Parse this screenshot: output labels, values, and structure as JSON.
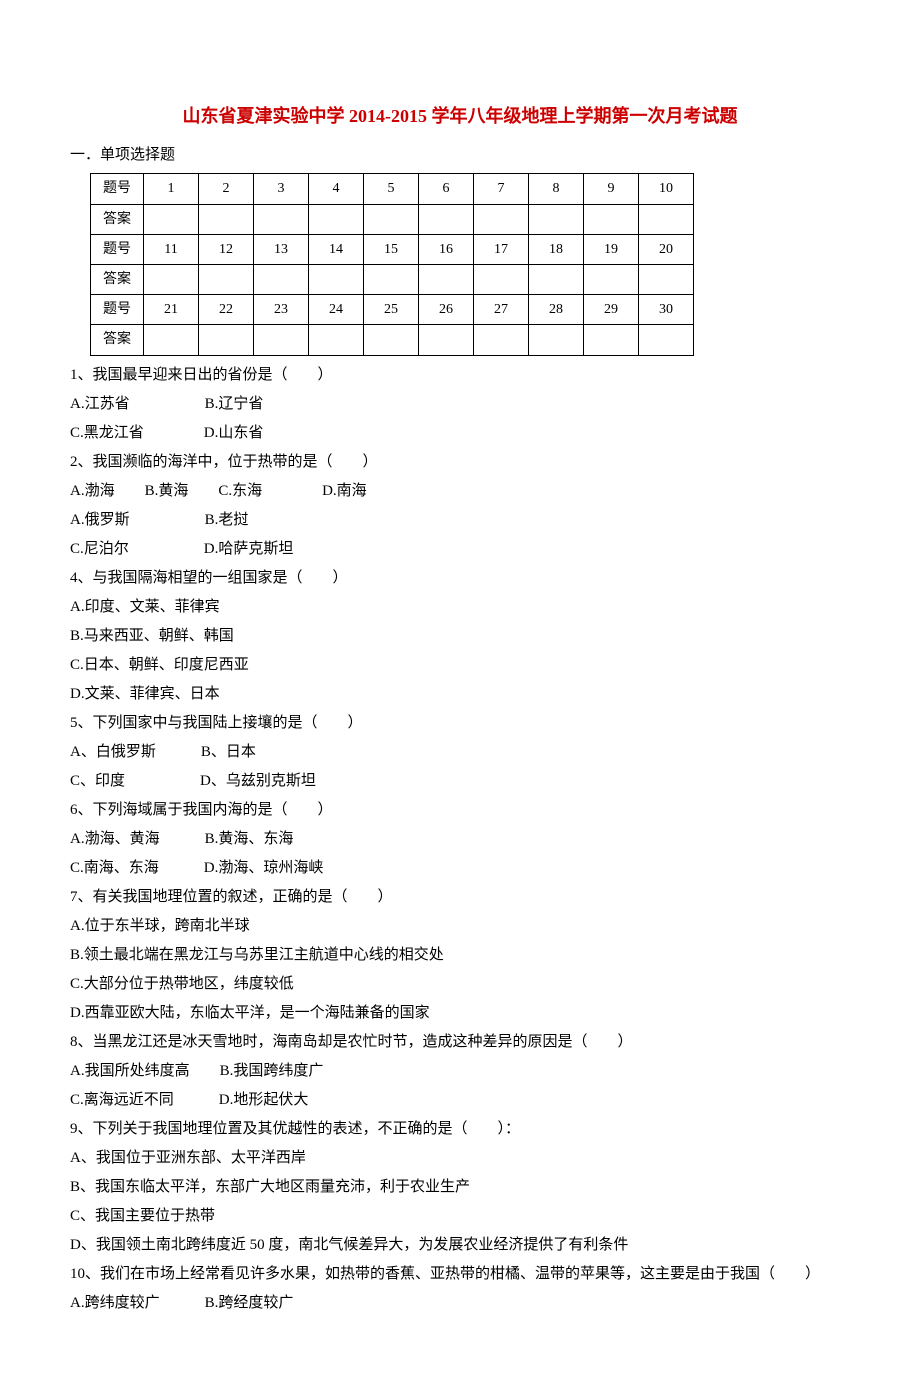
{
  "title": "山东省夏津实验中学 2014-2015 学年八年级地理上学期第一次月考试题",
  "section1_heading": "一．单项选择题",
  "grid": {
    "row_label_q": "题号",
    "row_label_a": "答案",
    "rows": [
      [
        "1",
        "2",
        "3",
        "4",
        "5",
        "6",
        "7",
        "8",
        "9",
        "10"
      ],
      [
        "11",
        "12",
        "13",
        "14",
        "15",
        "16",
        "17",
        "18",
        "19",
        "20"
      ],
      [
        "21",
        "22",
        "23",
        "24",
        "25",
        "26",
        "27",
        "28",
        "29",
        "30"
      ]
    ]
  },
  "questions": [
    {
      "stem": "1、我国最早迎来日出的省份是（　　）",
      "opts": [
        "A.江苏省　　　　　B.辽宁省",
        "C.黑龙江省　　　　D.山东省"
      ]
    },
    {
      "stem": "2、我国濒临的海洋中，位于热带的是（　　）",
      "opts": [
        "A.渤海　　B.黄海　　C.东海　　　　D.南海",
        "A.俄罗斯　　　　　B.老挝",
        " C.尼泊尔　　　　　D.哈萨克斯坦"
      ]
    },
    {
      "stem": "4、与我国隔海相望的一组国家是（　　）",
      "opts": [
        "A.印度、文莱、菲律宾",
        "B.马来西亚、朝鲜、韩国",
        "C.日本、朝鲜、印度尼西亚",
        "D.文莱、菲律宾、日本"
      ]
    },
    {
      "stem": "5、下列国家中与我国陆上接壤的是（　　）",
      "opts": [
        "A、白俄罗斯　　　B、日本",
        "C、印度　　　　　D、乌兹别克斯坦"
      ]
    },
    {
      "stem": "6、下列海域属于我国内海的是（　　）",
      "opts": [
        "A.渤海、黄海　　　B.黄海、东海",
        "C.南海、东海　　　D.渤海、琼州海峡"
      ]
    },
    {
      "stem": "7、有关我国地理位置的叙述，正确的是（　　）",
      "opts": [
        "A.位于东半球，跨南北半球",
        "B.领土最北端在黑龙江与乌苏里江主航道中心线的相交处",
        "C.大部分位于热带地区，纬度较低",
        "D.西靠亚欧大陆，东临太平洋，是一个海陆兼备的国家"
      ]
    },
    {
      "stem": "8、当黑龙江还是冰天雪地时，海南岛却是农忙时节，造成这种差异的原因是（　　）",
      "opts": [
        "A.我国所处纬度高　　B.我国跨纬度广",
        "C.离海远近不同　　　D.地形起伏大"
      ]
    },
    {
      "stem": "9、下列关于我国地理位置及其优越性的表述，不正确的是（　　）：",
      "opts": [
        "A、我国位于亚洲东部、太平洋西岸",
        "B、我国东临太平洋，东部广大地区雨量充沛，利于农业生产",
        "C、我国主要位于热带",
        "D、我国领土南北跨纬度近 50 度，南北气候差异大，为发展农业经济提供了有利条件"
      ]
    },
    {
      "stem": "10、我们在市场上经常看见许多水果，如热带的香蕉、亚热带的柑橘、温带的苹果等，这主要是由于我国（　　）",
      "opts": [
        "A.跨纬度较广　　　B.跨经度较广"
      ]
    }
  ]
}
